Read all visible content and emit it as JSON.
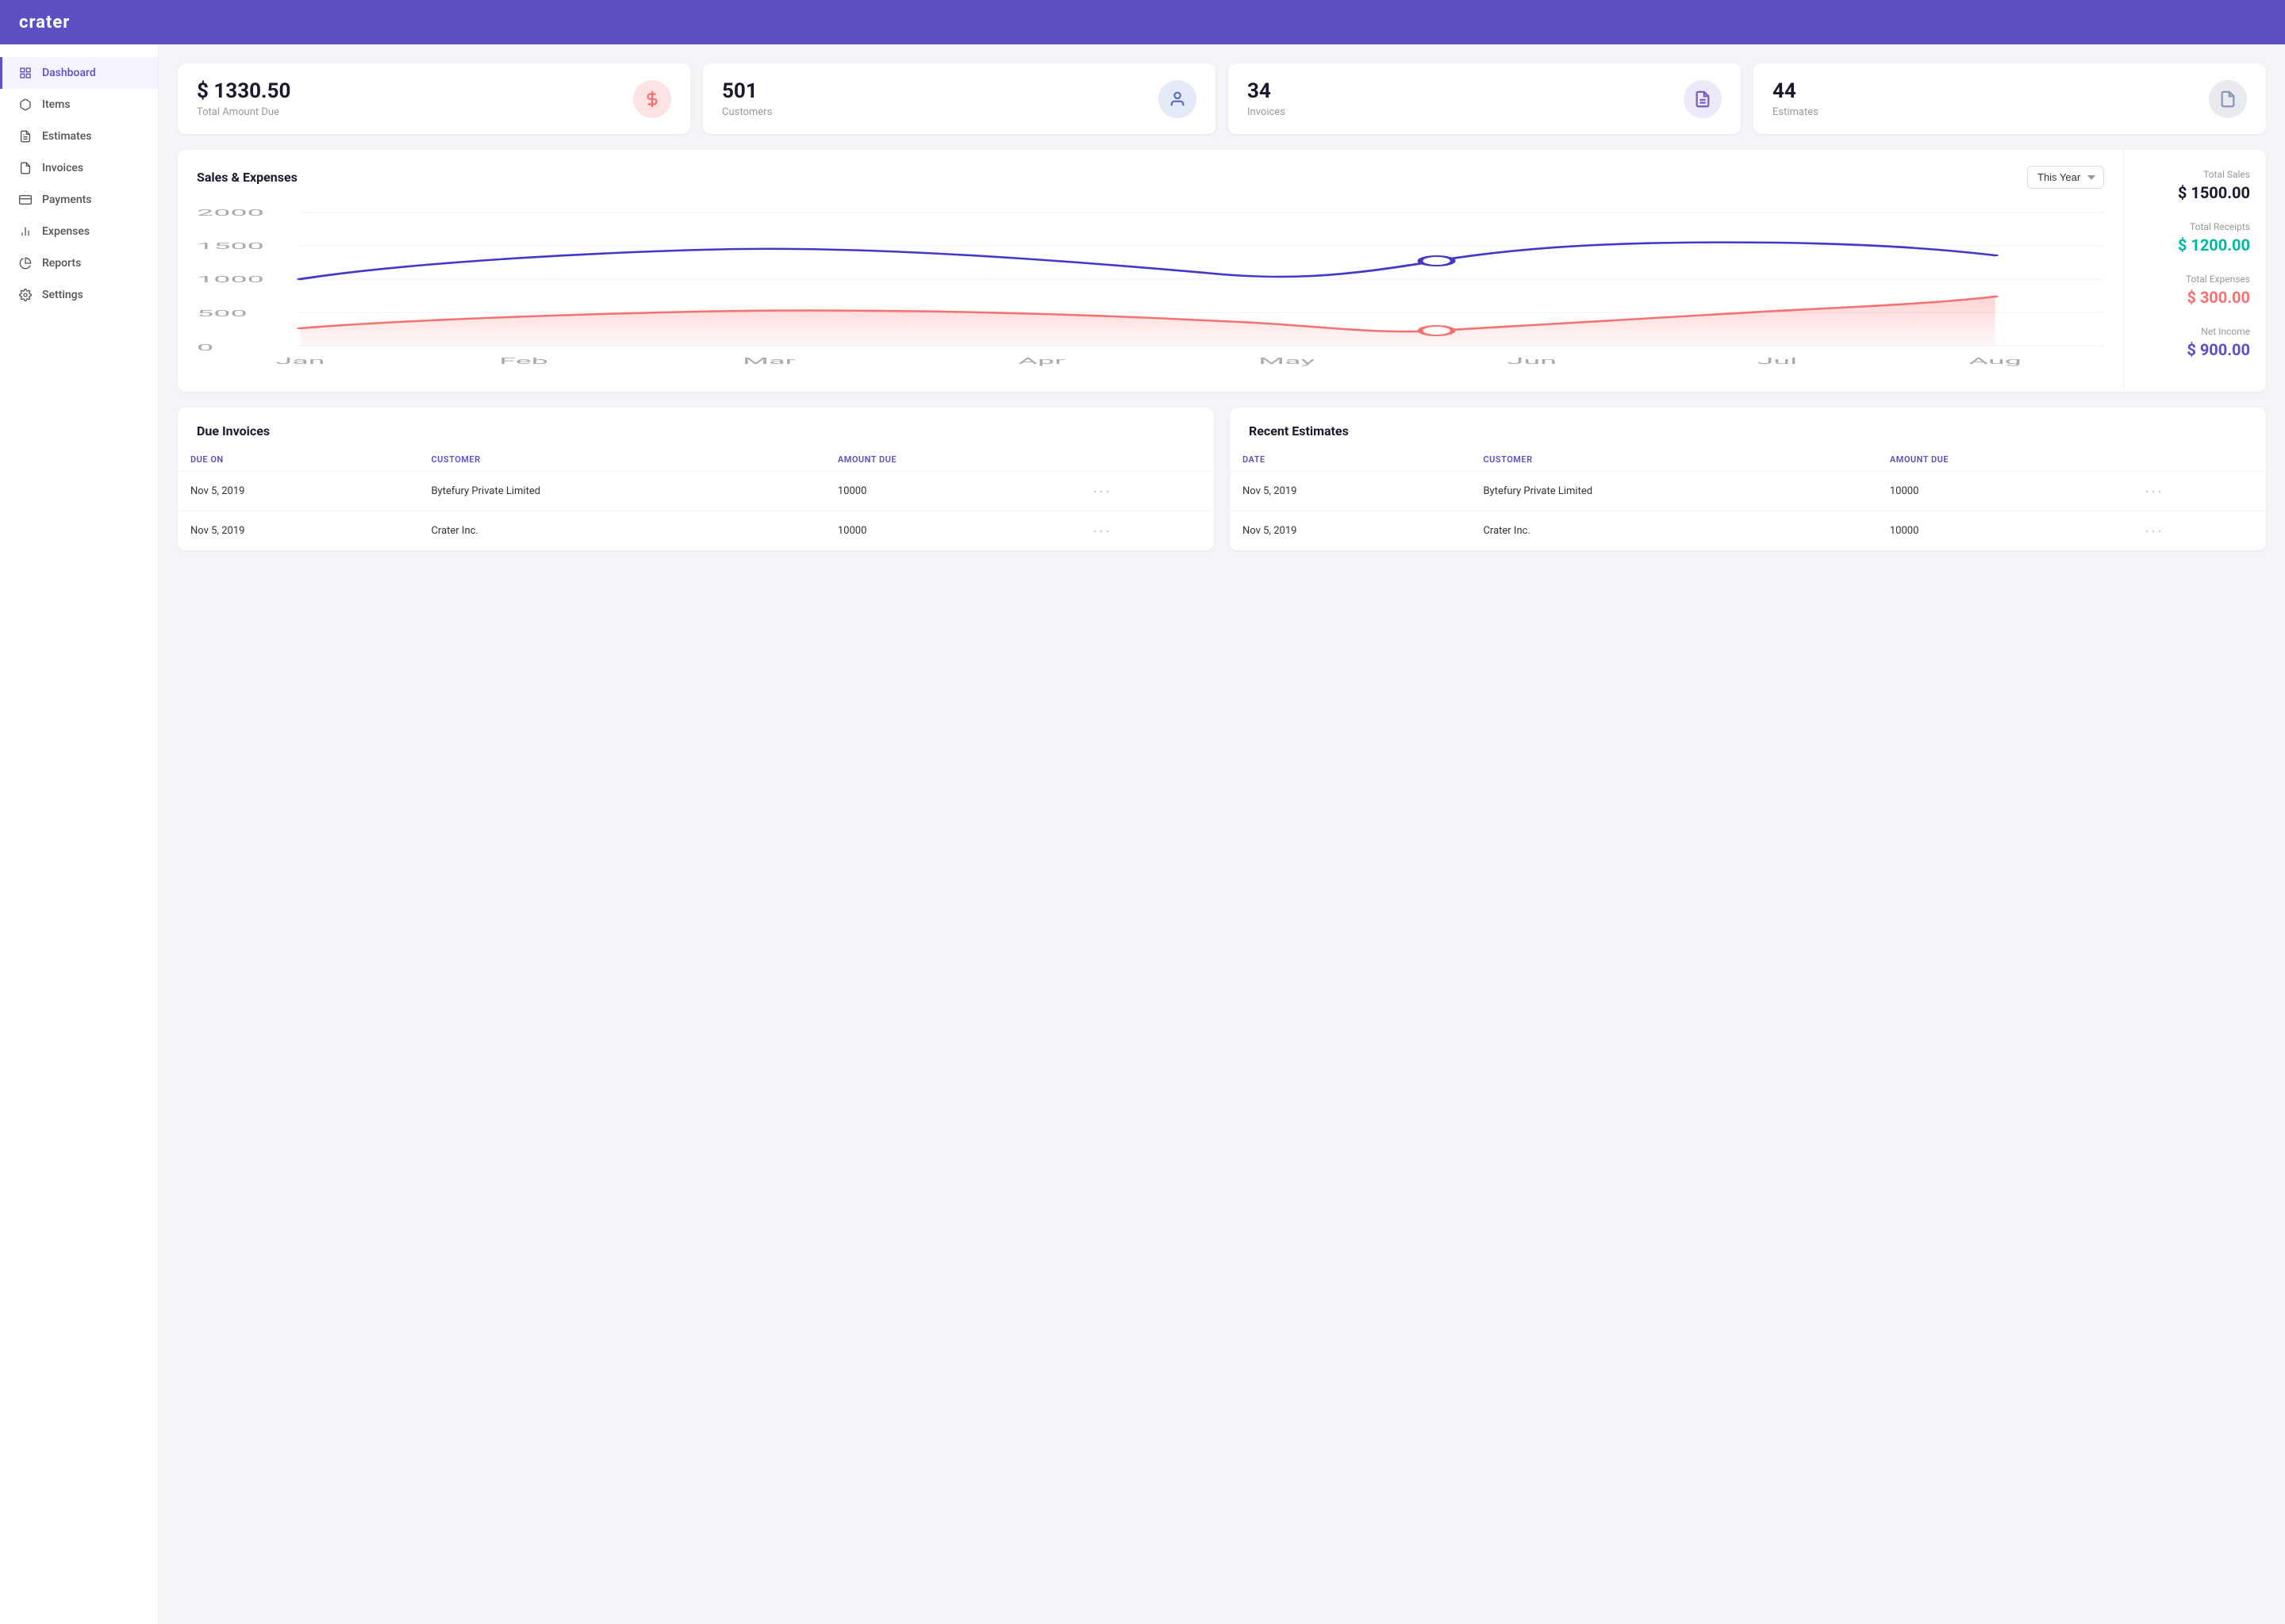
{
  "app": {
    "logo": "crater"
  },
  "sidebar": {
    "items": [
      {
        "id": "dashboard",
        "label": "Dashboard",
        "icon": "grid-icon",
        "active": true
      },
      {
        "id": "items",
        "label": "Items",
        "icon": "box-icon",
        "active": false
      },
      {
        "id": "estimates",
        "label": "Estimates",
        "icon": "file-text-icon",
        "active": false
      },
      {
        "id": "invoices",
        "label": "Invoices",
        "icon": "file-icon",
        "active": false
      },
      {
        "id": "payments",
        "label": "Payments",
        "icon": "credit-card-icon",
        "active": false
      },
      {
        "id": "expenses",
        "label": "Expenses",
        "icon": "bar-chart-icon",
        "active": false
      },
      {
        "id": "reports",
        "label": "Reports",
        "icon": "pie-chart-icon",
        "active": false
      },
      {
        "id": "settings",
        "label": "Settings",
        "icon": "gear-icon",
        "active": false
      }
    ]
  },
  "stats": [
    {
      "id": "total-amount-due",
      "value": "$ 1330.50",
      "label": "Total Amount Due",
      "icon": "dollar-icon",
      "icon_class": "icon-pink"
    },
    {
      "id": "customers",
      "value": "501",
      "label": "Customers",
      "icon": "user-icon",
      "icon_class": "icon-blue"
    },
    {
      "id": "invoices",
      "value": "34",
      "label": "Invoices",
      "icon": "invoice-icon",
      "icon_class": "icon-purple"
    },
    {
      "id": "estimates",
      "value": "44",
      "label": "Estimates",
      "icon": "estimate-icon",
      "icon_class": "icon-light"
    }
  ],
  "chart": {
    "title": "Sales & Expenses",
    "year_select_label": "This Year",
    "y_labels": [
      "2000",
      "1500",
      "1000",
      "500",
      "0"
    ],
    "x_labels": [
      "Jan",
      "Feb",
      "Mar",
      "Apr",
      "May",
      "Jun",
      "Jul",
      "Aug"
    ],
    "stats": [
      {
        "label": "Total Sales",
        "value": "$ 1500.00",
        "color": "color-dark"
      },
      {
        "label": "Total Receipts",
        "value": "$ 1200.00",
        "color": "color-teal"
      },
      {
        "label": "Total Expenses",
        "value": "$ 300.00",
        "color": "color-red"
      },
      {
        "label": "Net Income",
        "value": "$ 900.00",
        "color": "color-blue-v"
      }
    ]
  },
  "due_invoices": {
    "title": "Due Invoices",
    "columns": [
      "DUE ON",
      "CUSTOMER",
      "AMOUNT DUE",
      ""
    ],
    "rows": [
      {
        "due_on": "Nov 5, 2019",
        "customer": "Bytefury Private Limited",
        "amount": "10000"
      },
      {
        "due_on": "Nov 5, 2019",
        "customer": "Crater Inc.",
        "amount": "10000"
      }
    ]
  },
  "recent_estimates": {
    "title": "Recent Estimates",
    "columns": [
      "DATE",
      "CUSTOMER",
      "AMOUNT DUE",
      ""
    ],
    "rows": [
      {
        "date": "Nov 5, 2019",
        "customer": "Bytefury Private Limited",
        "amount": "10000"
      },
      {
        "date": "Nov 5, 2019",
        "customer": "Crater Inc.",
        "amount": "10000"
      }
    ]
  }
}
